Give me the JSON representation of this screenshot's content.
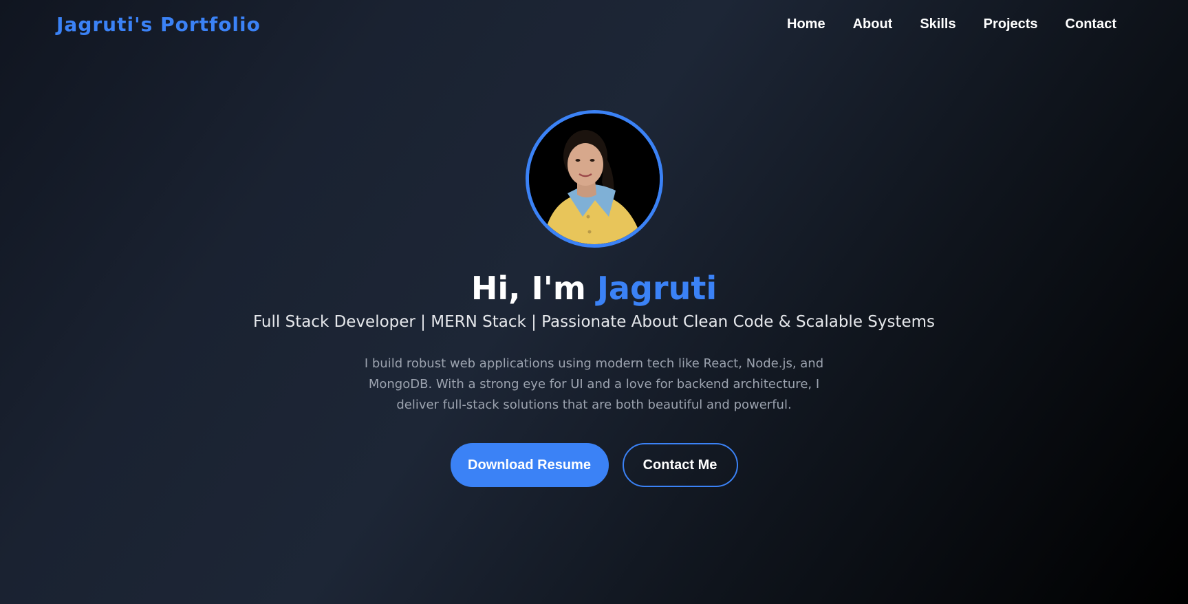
{
  "brand": {
    "title": "Jagruti's Portfolio"
  },
  "nav": {
    "items": [
      {
        "label": "Home"
      },
      {
        "label": "About"
      },
      {
        "label": "Skills"
      },
      {
        "label": "Projects"
      },
      {
        "label": "Contact"
      }
    ]
  },
  "hero": {
    "avatar_icon": "profile-photo",
    "greeting": "Hi, I'm ",
    "name": "Jagruti",
    "tagline": "Full Stack Developer | MERN Stack | Passionate About Clean Code & Scalable Systems",
    "bio": "I build robust web applications using modern tech like React, Node.js, and MongoDB. With a strong eye for UI and a love for backend architecture, I deliver full-stack solutions that are both beautiful and powerful.",
    "primary_button": "Download Resume",
    "secondary_button": "Contact Me"
  },
  "colors": {
    "accent": "#3b82f6",
    "background_start": "#101520",
    "background_end": "#000000",
    "text_primary": "#ffffff",
    "text_muted": "#9ca3af"
  }
}
